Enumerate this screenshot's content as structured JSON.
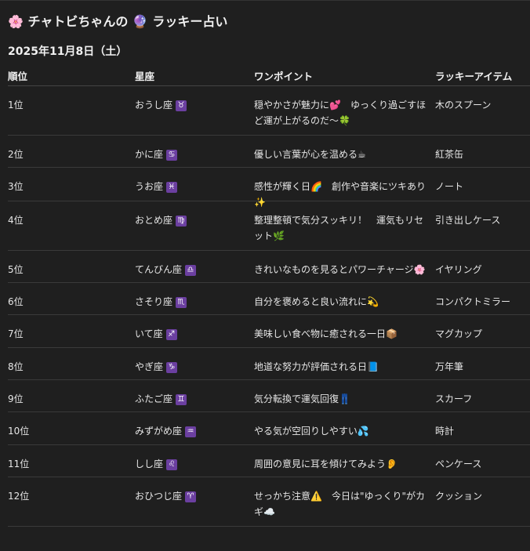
{
  "header": {
    "title": "🌸 チャトビちゃんの 🔮 ラッキー占い",
    "date": "2025年11月8日（土）"
  },
  "table": {
    "columns": [
      "順位",
      "星座",
      "ワンポイント",
      "ラッキーアイテム"
    ],
    "rows": [
      {
        "rank": "1位",
        "sign": "おうし座",
        "symbol": "♉",
        "point": "穏やかさが魅力に💕　ゆっくり過ごすほど運が上がるのだ〜🍀",
        "item": "木のスプーン"
      },
      {
        "rank": "2位",
        "sign": "かに座",
        "symbol": "♋",
        "point": "優しい言葉が心を温める☕",
        "item": "紅茶缶"
      },
      {
        "rank": "3位",
        "sign": "うお座",
        "symbol": "♓",
        "point": "感性が輝く日🌈　創作や音楽にツキあり✨",
        "item": "ノート"
      },
      {
        "rank": "4位",
        "sign": "おとめ座",
        "symbol": "♍",
        "point": "整理整頓で気分スッキリ！　運気もリセット🌿",
        "item": "引き出しケース"
      },
      {
        "rank": "5位",
        "sign": "てんびん座",
        "symbol": "♎",
        "point": "きれいなものを見るとパワーチャージ🌸",
        "item": "イヤリング"
      },
      {
        "rank": "6位",
        "sign": "さそり座",
        "symbol": "♏",
        "point": "自分を褒めると良い流れに💫",
        "item": "コンパクトミラー"
      },
      {
        "rank": "7位",
        "sign": "いて座",
        "symbol": "♐",
        "point": "美味しい食べ物に癒される一日📦",
        "item": "マグカップ"
      },
      {
        "rank": "8位",
        "sign": "やぎ座",
        "symbol": "♑",
        "point": "地道な努力が評価される日📘",
        "item": "万年筆"
      },
      {
        "rank": "9位",
        "sign": "ふたご座",
        "symbol": "♊",
        "point": "気分転換で運気回復👖",
        "item": "スカーフ"
      },
      {
        "rank": "10位",
        "sign": "みずがめ座",
        "symbol": "♒",
        "point": "やる気が空回りしやすい💦",
        "item": "時計"
      },
      {
        "rank": "11位",
        "sign": "しし座",
        "symbol": "♌",
        "point": "周囲の意見に耳を傾けてみよう👂",
        "item": "ペンケース"
      },
      {
        "rank": "12位",
        "sign": "おひつじ座",
        "symbol": "♈",
        "point": "せっかち注意⚠️　今日は\"ゆっくり\"がカギ☁️",
        "item": "クッション"
      }
    ]
  }
}
